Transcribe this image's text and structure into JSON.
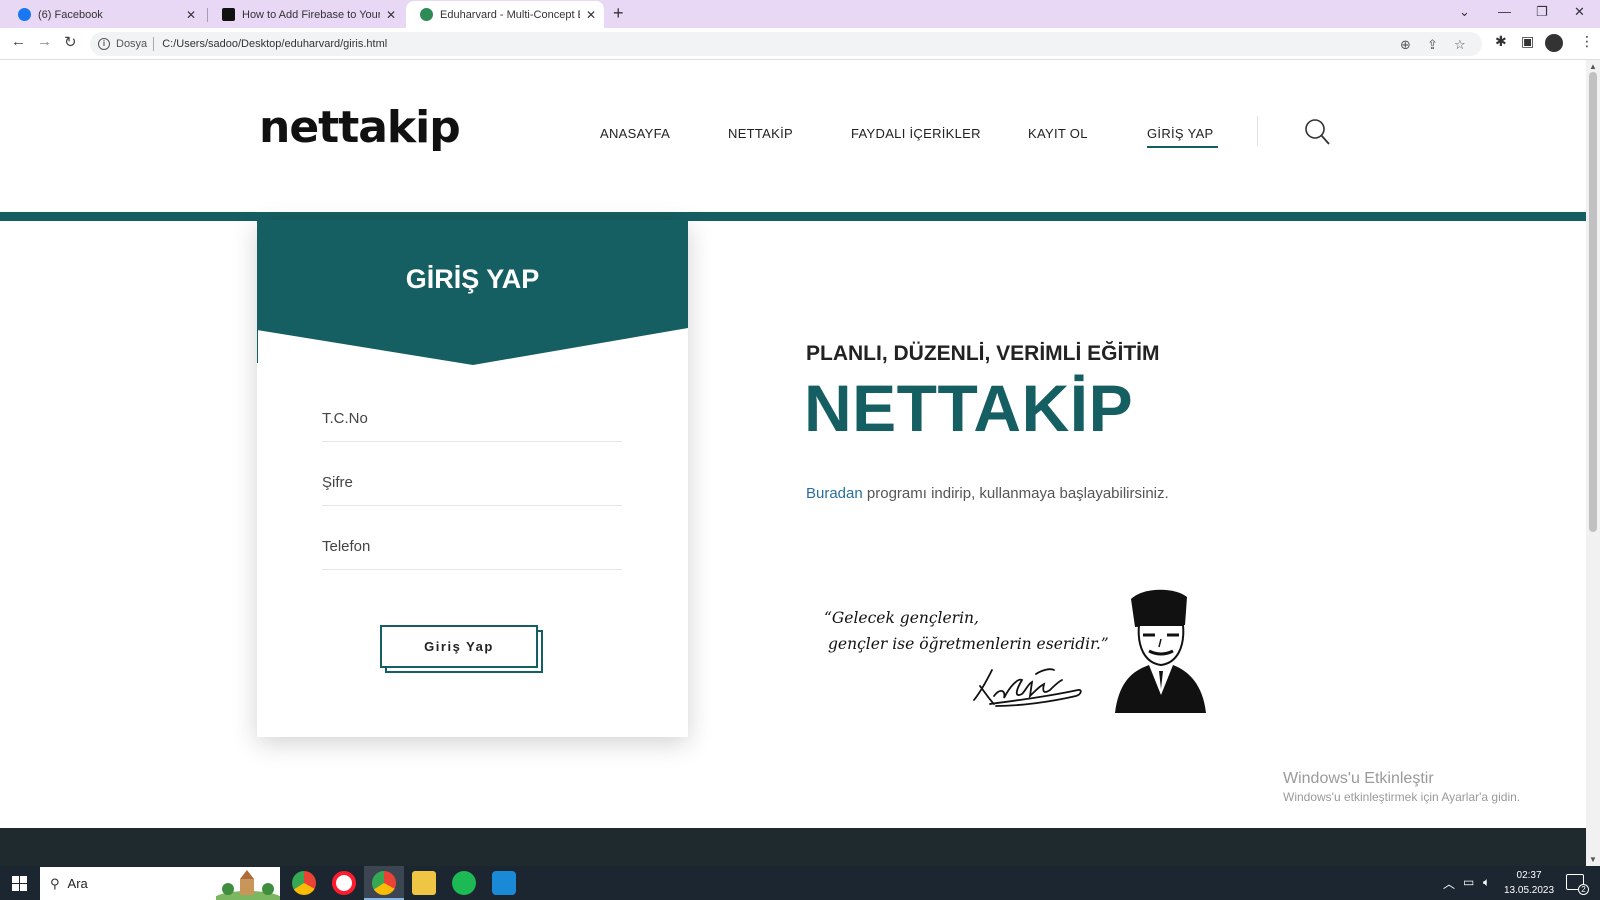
{
  "browser": {
    "tabs": [
      {
        "title": "(6) Facebook",
        "favicon_color": "#1877f2"
      },
      {
        "title": "How to Add Firebase to Your Java",
        "favicon_color": "#111111"
      },
      {
        "title": "Eduharvard - Multi-Concept Edu",
        "favicon_color": "#2e8b57"
      }
    ],
    "new_tab_label": "+",
    "scheme_label": "Dosya",
    "url": "C:/Users/sadoo/Desktop/eduharvard/giris.html"
  },
  "site": {
    "logo": "nettakip",
    "menu": [
      "ANASAYFA",
      "NETTAKİP",
      "FAYDALI İÇERİKLER",
      "KAYIT OL",
      "GİRİŞ YAP"
    ],
    "active_menu": "GİRİŞ YAP",
    "accent_color": "#155f62"
  },
  "login": {
    "title": "GİRİŞ YAP",
    "fields": [
      {
        "placeholder": "T.C.No"
      },
      {
        "placeholder": "Şifre"
      },
      {
        "placeholder": "Telefon"
      }
    ],
    "submit_label": "Giriş Yap"
  },
  "hero": {
    "tagline": "PLANLI, DÜZENLİ, VERİMLİ EĞİTİM",
    "title": "NETTAKİP",
    "download_link": "Buradan",
    "download_text": "programı indirip, kullanmaya başlayabilirsiniz.",
    "quote_line1": "“Gelecek gençlerin,",
    "quote_line2": "gençler ise öğretmenlerin eseridir.”",
    "signature_name": "K. Atatürk"
  },
  "watermark": {
    "title": "Windows'u Etkinleştir",
    "subtitle": "Windows'u etkinleştirmek için Ayarlar'a gidin."
  },
  "taskbar": {
    "search_label": "Ara",
    "time": "02:37",
    "date": "13.05.2023",
    "notifications": "2"
  }
}
